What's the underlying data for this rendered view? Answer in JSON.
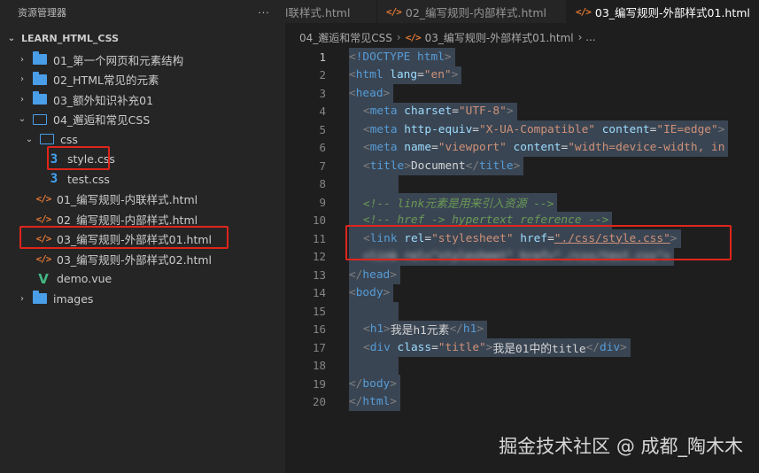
{
  "explorer": {
    "title": "资源管理器",
    "more": "···",
    "root": "LEARN_HTML_CSS",
    "items": [
      {
        "label": "01_第一个网页和元素结构",
        "kind": "folder",
        "chev": "›"
      },
      {
        "label": "02_HTML常见的元素",
        "kind": "folder",
        "chev": "›"
      },
      {
        "label": "03_额外知识补充01",
        "kind": "folder",
        "chev": "›"
      },
      {
        "label": "04_邂逅和常见CSS",
        "kind": "folder-open",
        "chev": "⌄"
      },
      {
        "label": "css",
        "kind": "folder-open",
        "chev": "⌄"
      },
      {
        "label": "style.css",
        "kind": "css",
        "icon": "3"
      },
      {
        "label": "test.css",
        "kind": "css",
        "icon": "3"
      },
      {
        "label": "01_编写规则-内联样式.html",
        "kind": "html",
        "icon": "</>"
      },
      {
        "label": "02_编写规则-内部样式.html",
        "kind": "html",
        "icon": "</>"
      },
      {
        "label": "03_编写规则-外部样式01.html",
        "kind": "html",
        "icon": "</>"
      },
      {
        "label": "03_编写规则-外部样式02.html",
        "kind": "html",
        "icon": "</>"
      },
      {
        "label": "demo.vue",
        "kind": "vue",
        "icon": "V"
      },
      {
        "label": "images",
        "kind": "folder",
        "chev": "›"
      }
    ]
  },
  "tabs": [
    {
      "label": "l联样式.html",
      "icon": ""
    },
    {
      "label": "02_编写规则-内部样式.html",
      "icon": "</>"
    },
    {
      "label": "03_编写规则-外部样式01.html",
      "icon": "</>"
    }
  ],
  "breadcrumb": {
    "folder": "04_邂逅和常见CSS",
    "sep": "›",
    "icon": "</>",
    "file": "03_编写规则-外部样式01.html",
    "tail": "› ..."
  },
  "code": {
    "line_numbers": [
      "1",
      "2",
      "3",
      "4",
      "5",
      "6",
      "7",
      "8",
      "9",
      "10",
      "11",
      "12",
      "13",
      "14",
      "15",
      "16",
      "17",
      "18",
      "19",
      "20"
    ],
    "l1": {
      "open": "<",
      "doctype": "!DOCTYPE html",
      "close": ">"
    },
    "l2": {
      "open": "<",
      "tag": "html",
      "attr": " lang",
      "eq": "=",
      "val": "\"en\"",
      "close": ">"
    },
    "l3": {
      "open": "<",
      "tag": "head",
      "close": ">"
    },
    "l4": {
      "open": "<",
      "tag": "meta",
      "attr": " charset",
      "eq": "=",
      "val": "\"UTF-8\"",
      "close": ">"
    },
    "l5": {
      "open": "<",
      "tag": "meta",
      "attr1": " http-equiv",
      "eq": "=",
      "val1": "\"X-UA-Compatible\"",
      "attr2": " content",
      "val2": "\"IE=edge\"",
      "close": ">"
    },
    "l6": {
      "open": "<",
      "tag": "meta",
      "attr1": " name",
      "eq": "=",
      "val1": "\"viewport\"",
      "attr2": " content",
      "val2": "\"width=device-width, in"
    },
    "l7": {
      "open": "<",
      "tag": "title",
      "close": ">",
      "text": "Document",
      "open2": "</",
      "tag2": "title",
      "close2": ">"
    },
    "l9": "<!-- link元素是用来引入资源 -->",
    "l10": "<!-- href -> hypertext reference -->",
    "l11": {
      "open": "<",
      "tag": "link",
      "attr1": " rel",
      "eq": "=",
      "val1": "\"stylesheet\"",
      "attr2": " href",
      "val2": "\"./css/style.css\"",
      "close": ">"
    },
    "l12": "<link rel=\"stylesheet\" href=\"./css/test.css\">",
    "l13": {
      "open": "</",
      "tag": "head",
      "close": ">"
    },
    "l14": {
      "open": "<",
      "tag": "body",
      "close": ">"
    },
    "l16": {
      "open": "<",
      "tag": "h1",
      "close": ">",
      "text": "我是h1元素",
      "open2": "</",
      "tag2": "h1",
      "close2": ">"
    },
    "l17": {
      "open": "<",
      "tag": "div",
      "attr": " class",
      "eq": "=",
      "val": "\"title\"",
      "close": ">",
      "text": "我是01中的title",
      "open2": "</",
      "tag2": "div",
      "close2": ">"
    },
    "l19": {
      "open": "</",
      "tag": "body",
      "close": ">"
    },
    "l20": {
      "open": "</",
      "tag": "html",
      "close": ">"
    }
  },
  "watermark": "掘金技术社区 @ 成都_陶木木",
  "colors": {
    "highlight": "#e0251b",
    "accent": "#4a9ee8"
  }
}
